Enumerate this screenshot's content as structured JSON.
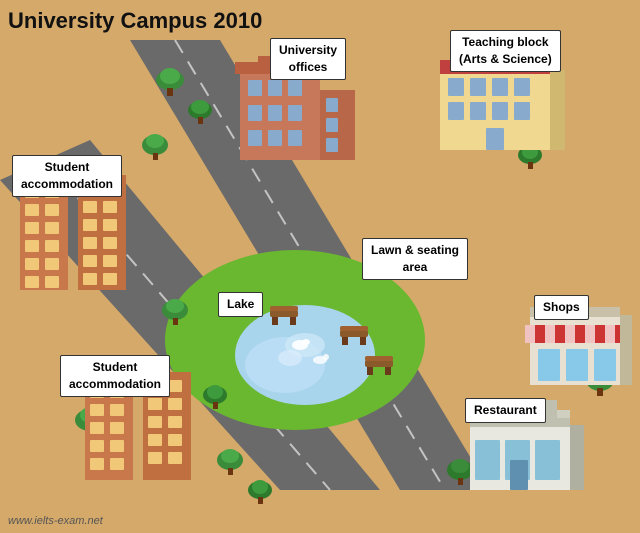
{
  "title": "University Campus 2010",
  "labels": {
    "university_offices": "University\noffices",
    "teaching_block": "Teaching block\n(Arts & Science)",
    "student_accommodation_top": "Student\naccommodation",
    "student_accommodation_bottom": "Student\naccommodation",
    "lawn_seating": "Lawn & seating\narea",
    "lake": "Lake",
    "shops": "Shops",
    "restaurant": "Restaurant"
  },
  "footer": "www.ielts-exam.net",
  "colors": {
    "background": "#d4a96a",
    "road": "#5a5a5a",
    "road_line": "#ffffff",
    "grass": "#7bc44c",
    "lake": "#b0d8f0",
    "tree_dark": "#2d7a2d",
    "tree_light": "#4aaa4a",
    "building_brick": "#c0704a",
    "building_wall": "#f0d890",
    "building_roof": "#c04040",
    "label_bg": "#ffffff",
    "label_border": "#222222"
  }
}
